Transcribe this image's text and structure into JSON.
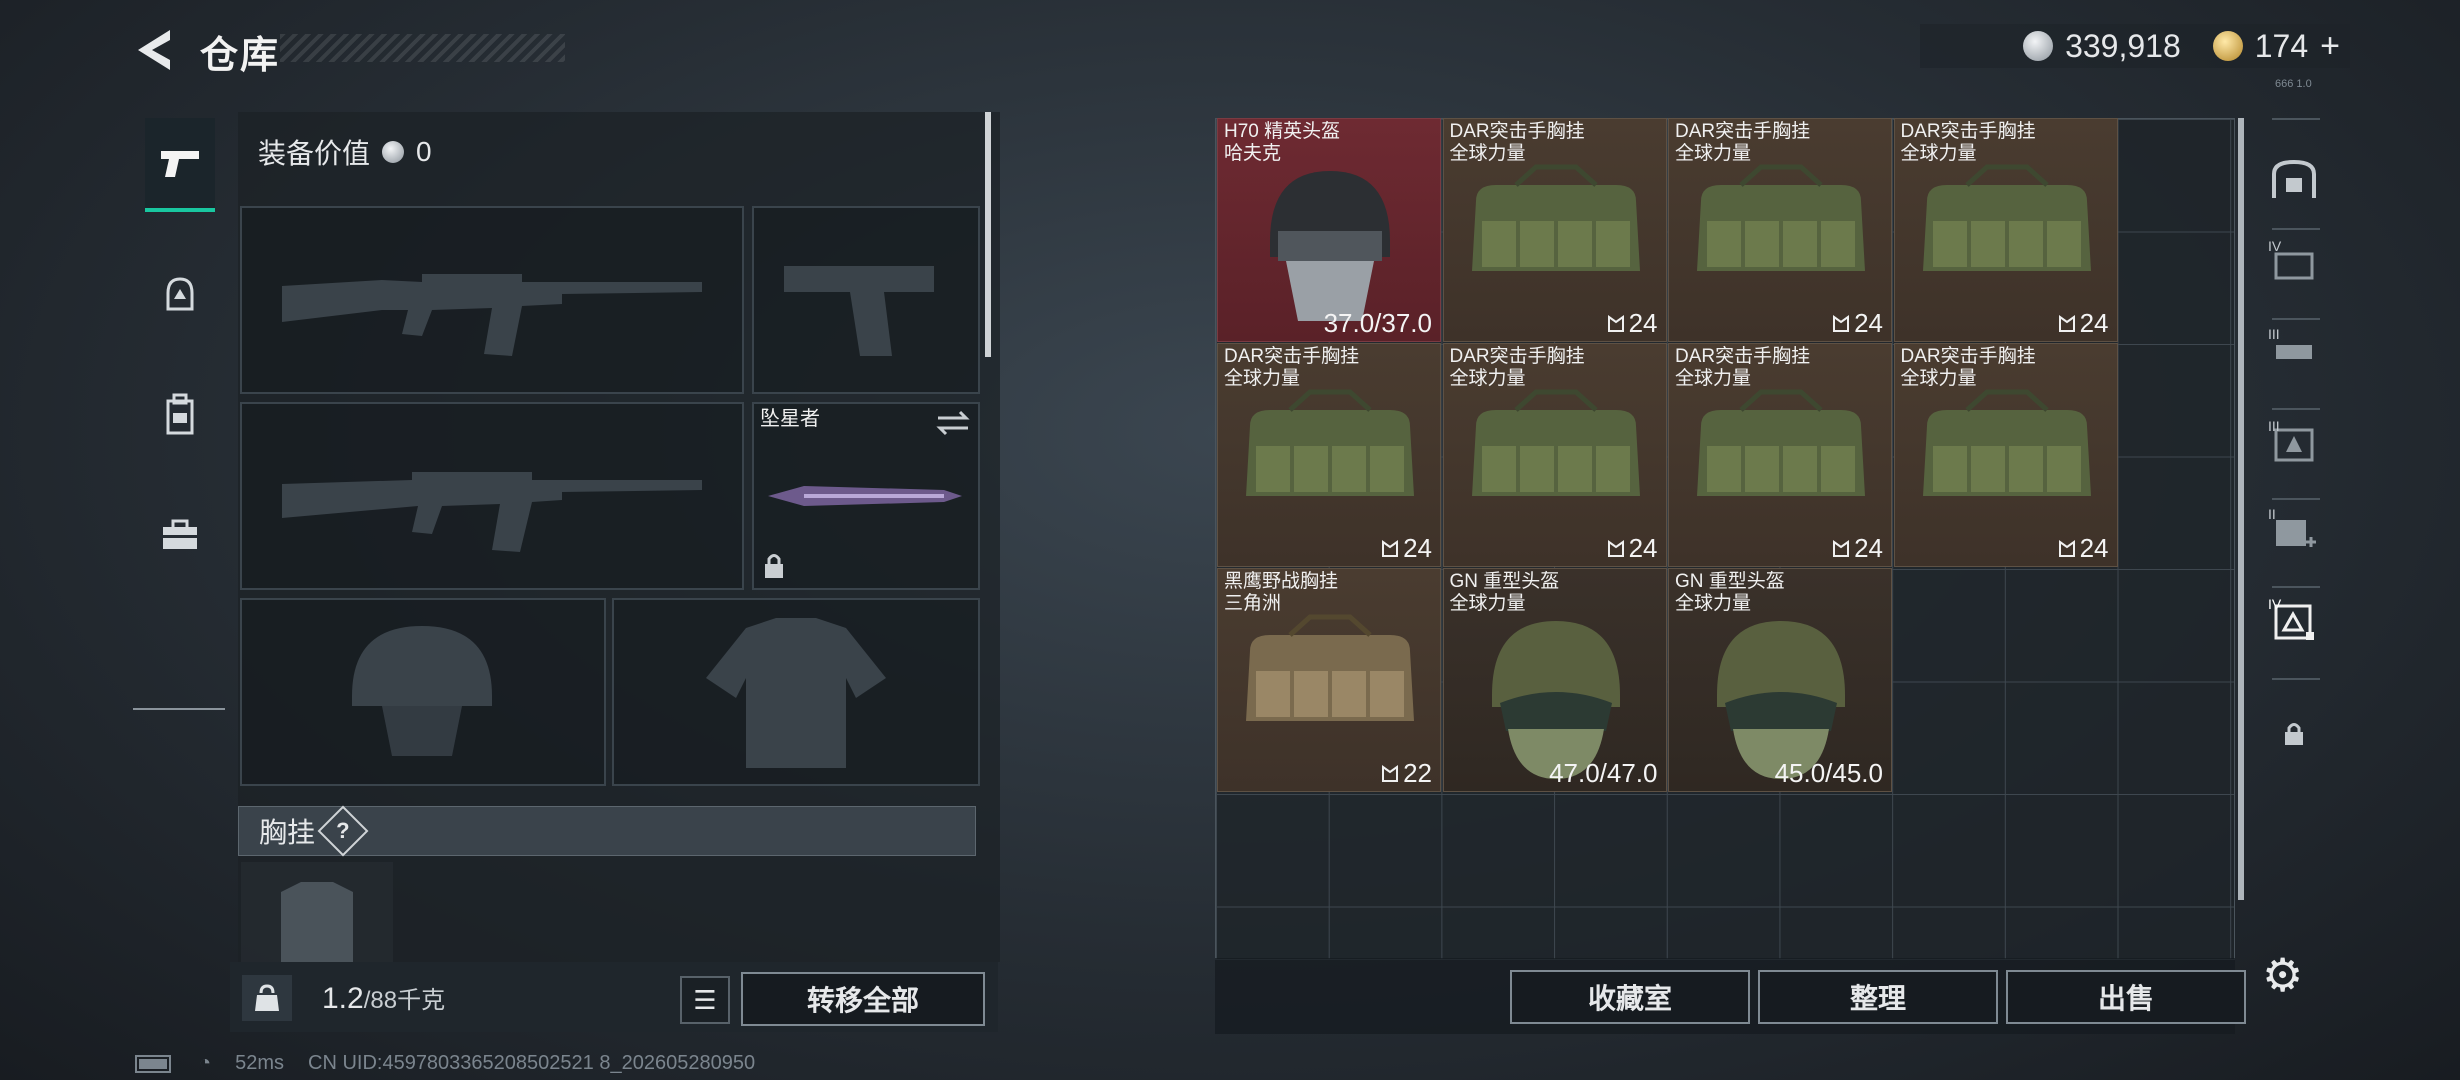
{
  "header": {
    "title": "仓库",
    "silver_amount": "339,918",
    "gold_amount": "174",
    "gold_plus": "+",
    "version_tag": "666 1.0"
  },
  "loadout": {
    "equip_value_label": "装备价值",
    "equip_value": "0",
    "melee_name": "坠星者",
    "chest_rig_label": "胸挂",
    "chest_help": "?"
  },
  "inventory": {
    "weight_current": "1.2",
    "weight_max": "/88千克",
    "transfer_all_label": "转移全部"
  },
  "storage": {
    "items": [
      {
        "name": "H70 精英头盔",
        "sub": "哈夫克",
        "value": "37.0/37.0",
        "kind": "helmet-black",
        "tone": "red"
      },
      {
        "name": "DAR突击手胸挂",
        "sub": "全球力量",
        "value": "24",
        "kind": "rig-green",
        "tone": "brown"
      },
      {
        "name": "DAR突击手胸挂",
        "sub": "全球力量",
        "value": "24",
        "kind": "rig-green",
        "tone": "brown"
      },
      {
        "name": "DAR突击手胸挂",
        "sub": "全球力量",
        "value": "24",
        "kind": "rig-green",
        "tone": "brown"
      },
      {
        "name": "DAR突击手胸挂",
        "sub": "全球力量",
        "value": "24",
        "kind": "rig-green",
        "tone": "brown"
      },
      {
        "name": "DAR突击手胸挂",
        "sub": "全球力量",
        "value": "24",
        "kind": "rig-green",
        "tone": "brown"
      },
      {
        "name": "DAR突击手胸挂",
        "sub": "全球力量",
        "value": "24",
        "kind": "rig-green",
        "tone": "brown"
      },
      {
        "name": "DAR突击手胸挂",
        "sub": "全球力量",
        "value": "24",
        "kind": "rig-green",
        "tone": "brown"
      },
      {
        "name": "黑鹰野战胸挂",
        "sub": "三角洲",
        "value": "22",
        "kind": "rig-tan",
        "tone": "brown"
      },
      {
        "name": "GN 重型头盔",
        "sub": "全球力量",
        "value": "47.0/47.0",
        "kind": "helmet-green",
        "tone": "dark"
      },
      {
        "name": "GN 重型头盔",
        "sub": "全球力量",
        "value": "45.0/45.0",
        "kind": "helmet-green",
        "tone": "dark"
      }
    ],
    "buttons": {
      "collection": "收藏室",
      "sort": "整理",
      "sell": "出售"
    }
  },
  "status": {
    "ping": "52ms",
    "uid": "CN UID:4597803365208502521 8_202605280950"
  },
  "rail_labels": [
    "IV",
    "III",
    "III",
    "II",
    "IV"
  ]
}
